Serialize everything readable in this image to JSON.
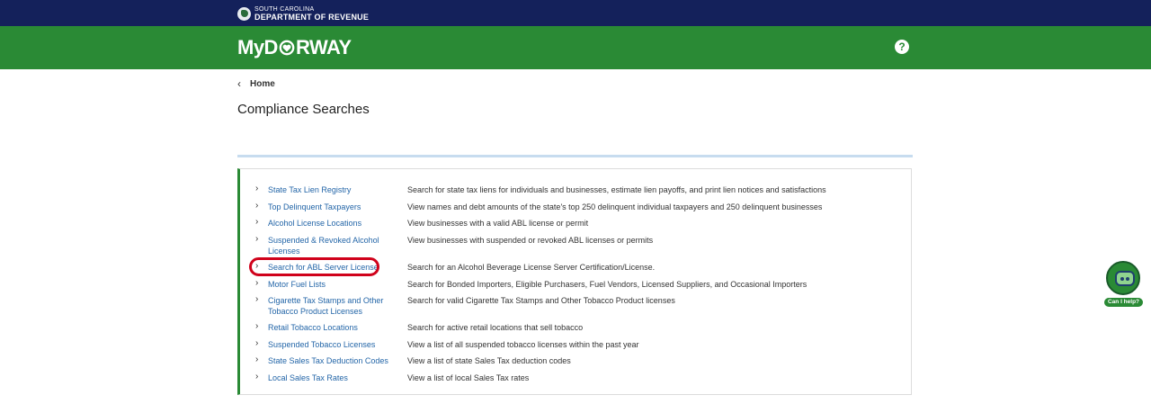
{
  "header": {
    "agency_line1": "SOUTH CAROLINA",
    "agency_line2": "DEPARTMENT OF REVENUE",
    "brand": "MyDORWAY",
    "brand_prefix": "MyD",
    "brand_suffix": "RWAY",
    "help_label": "?"
  },
  "breadcrumb": {
    "label": "Home",
    "chevron": "‹"
  },
  "page": {
    "title": "Compliance Searches"
  },
  "searches": [
    {
      "label": "State Tax Lien Registry",
      "description": "Search for state tax liens for individuals and businesses, estimate lien payoffs, and print lien notices and satisfactions"
    },
    {
      "label": "Top Delinquent Taxpayers",
      "description": "View names and debt amounts of the state's top 250 delinquent individual taxpayers and 250 delinquent businesses"
    },
    {
      "label": "Alcohol License Locations",
      "description": "View businesses with a valid ABL license or permit"
    },
    {
      "label": "Suspended & Revoked Alcohol Licenses",
      "description": "View businesses with suspended or revoked ABL licenses or permits"
    },
    {
      "label": "Search for ABL Server License",
      "description": "Search for an Alcohol Beverage License Server Certification/License."
    },
    {
      "label": "Motor Fuel Lists",
      "description": "Search for Bonded Importers, Eligible Purchasers, Fuel Vendors, Licensed Suppliers, and Occasional Importers"
    },
    {
      "label": "Cigarette Tax Stamps and Other Tobacco Product Licenses",
      "description": "Search for valid Cigarette Tax Stamps and Other Tobacco Product licenses"
    },
    {
      "label": "Retail Tobacco Locations",
      "description": "Search for active retail locations that sell tobacco"
    },
    {
      "label": "Suspended Tobacco Licenses",
      "description": "View a list of all suspended tobacco licenses within the past year"
    },
    {
      "label": "State Sales Tax Deduction Codes",
      "description": "View a list of state Sales Tax deduction codes"
    },
    {
      "label": "Local Sales Tax Rates",
      "description": "View a list of local Sales Tax rates"
    }
  ],
  "chatbot": {
    "label": "Can I help?"
  },
  "colors": {
    "navy": "#14215b",
    "green": "#2a8a35",
    "link": "#2466a8",
    "highlight": "#d0021b"
  }
}
